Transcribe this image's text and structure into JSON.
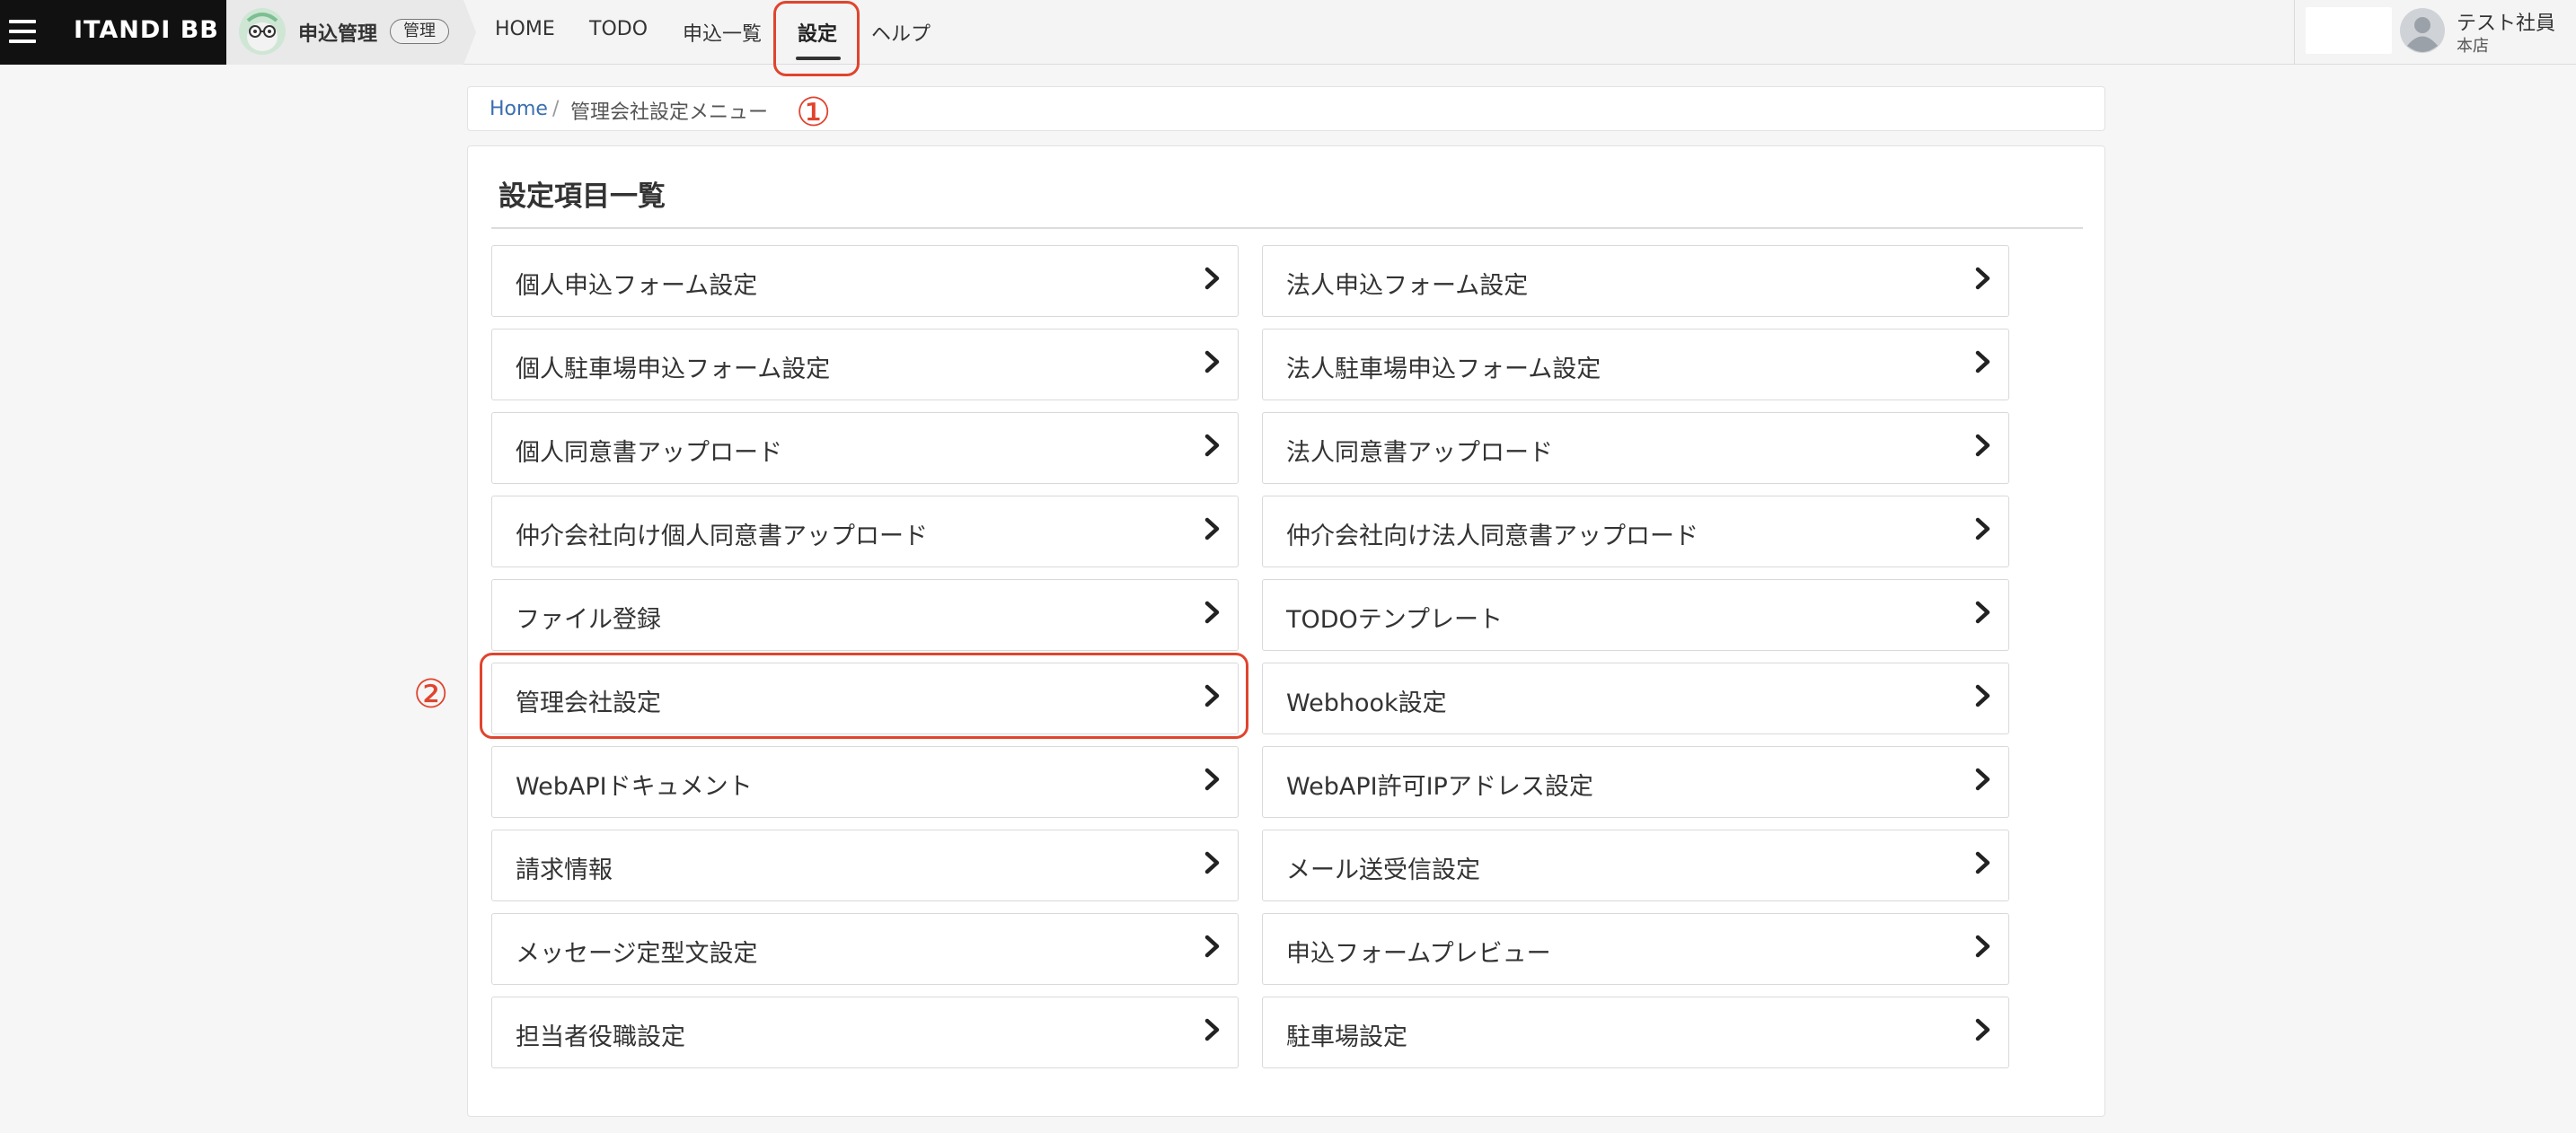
{
  "header": {
    "logo": "ITANDI BB",
    "product_name": "申込管理",
    "product_badge": "管理",
    "nav": [
      "HOME",
      "TODO",
      "申込一覧",
      "設定",
      "ヘルプ"
    ],
    "active_nav": "設定",
    "user_name": "テスト社員",
    "user_shop": "本店"
  },
  "breadcrumb": {
    "home": "Home",
    "separator": "/",
    "current": "管理会社設定メニュー"
  },
  "panel": {
    "title": "設定項目一覧",
    "left_items": [
      "個人申込フォーム設定",
      "個人駐車場申込フォーム設定",
      "個人同意書アップロード",
      "仲介会社向け個人同意書アップロード",
      "ファイル登録",
      "管理会社設定",
      "WebAPIドキュメント",
      "請求情報",
      "メッセージ定型文設定",
      "担当者役職設定"
    ],
    "right_items": [
      "法人申込フォーム設定",
      "法人駐車場申込フォーム設定",
      "法人同意書アップロード",
      "仲介会社向け法人同意書アップロード",
      "TODOテンプレート",
      "Webhook設定",
      "WebAPI許可IPアドレス設定",
      "メール送受信設定",
      "申込フォームプレビュー",
      "駐車場設定"
    ]
  },
  "annotations": {
    "marker_1": "①",
    "marker_2": "②",
    "color": "#e0442e"
  }
}
